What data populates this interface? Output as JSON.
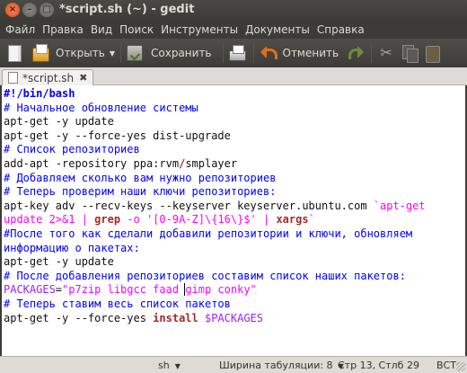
{
  "window": {
    "title": "*script.sh (~) - gedit",
    "close_glyph": "×",
    "minimize_glyph": "–",
    "maximize_glyph": "□"
  },
  "menu": [
    "Файл",
    "Правка",
    "Вид",
    "Поиск",
    "Инструменты",
    "Документы",
    "Справка"
  ],
  "toolbar": {
    "open_label": "Открыть",
    "save_label": "Сохранить",
    "undo_label": "Отменить",
    "dropdown_glyph": "▼",
    "cut_glyph": "✂"
  },
  "tab": {
    "label": "*script.sh",
    "close_glyph": "✖"
  },
  "editor": {
    "lines": [
      [
        {
          "t": "#!/bin/bash",
          "c": "shebang"
        }
      ],
      [
        {
          "t": "# Начальное обновление системы",
          "c": "comment"
        }
      ],
      [
        {
          "t": "apt-get -y update",
          "c": "text"
        }
      ],
      [
        {
          "t": "apt-get -y --force-yes dist-upgrade",
          "c": "text"
        }
      ],
      [
        {
          "t": "# Список репозиториев",
          "c": "comment"
        }
      ],
      [
        {
          "t": "add-apt -repository ppa:rvm",
          "c": "text"
        },
        {
          "t": "/",
          "c": "kw"
        },
        {
          "t": "smplayer",
          "c": "text"
        }
      ],
      [
        {
          "t": "# Добавляем сколько вам нужно репозиториев",
          "c": "comment"
        }
      ],
      [
        {
          "t": "# Теперь проверим наши ключи репозиториев:",
          "c": "comment"
        }
      ],
      [
        {
          "t": "apt-key adv --recv-keys --keyserver keyserver.ubuntu.com ",
          "c": "text"
        },
        {
          "t": "`apt-get",
          "c": "str"
        }
      ],
      [
        {
          "t": "update 2>&1 | ",
          "c": "str"
        },
        {
          "t": "grep",
          "c": "kw"
        },
        {
          "t": " -o '[0-9A-Z]\\{16\\}$' | ",
          "c": "str"
        },
        {
          "t": "xargs",
          "c": "kw"
        },
        {
          "t": "`",
          "c": "str"
        }
      ],
      [
        {
          "t": "#После того как сделали добавили репозитории и ключи, обновляем",
          "c": "comment"
        }
      ],
      [
        {
          "t": "информацию о пакетах:",
          "c": "comment"
        }
      ],
      [
        {
          "t": "apt-get -y update",
          "c": "text"
        }
      ],
      [
        {
          "t": "# После добавления репозиториев составим список наших пакетов:",
          "c": "comment"
        }
      ],
      [
        {
          "t": "PACKAGES",
          "c": "var"
        },
        {
          "t": "=",
          "c": "text"
        },
        {
          "t": "\"p7zip libgcc faad ",
          "c": "str"
        },
        {
          "t": "|",
          "c": "cursor"
        },
        {
          "t": "gimp conky\"",
          "c": "str"
        }
      ],
      [
        {
          "t": "# Теперь ставим весь список пакетов",
          "c": "comment"
        }
      ],
      [
        {
          "t": "apt-get -y --force-yes ",
          "c": "text"
        },
        {
          "t": "install",
          "c": "kw"
        },
        {
          "t": " ",
          "c": "text"
        },
        {
          "t": "$PACKAGES",
          "c": "var"
        }
      ]
    ]
  },
  "status": {
    "language": "sh",
    "tab_width": "Ширина табуляции: 8",
    "position": "Стр 13, Стлб 29",
    "mode": "ВСТ",
    "dropdown_glyph": "▼"
  },
  "colors": {
    "comment": "#0000ff",
    "string": "#ff00ff",
    "variable": "#a020f0",
    "keyword": "#a52a2a",
    "window_bg": "#3c3b37"
  }
}
